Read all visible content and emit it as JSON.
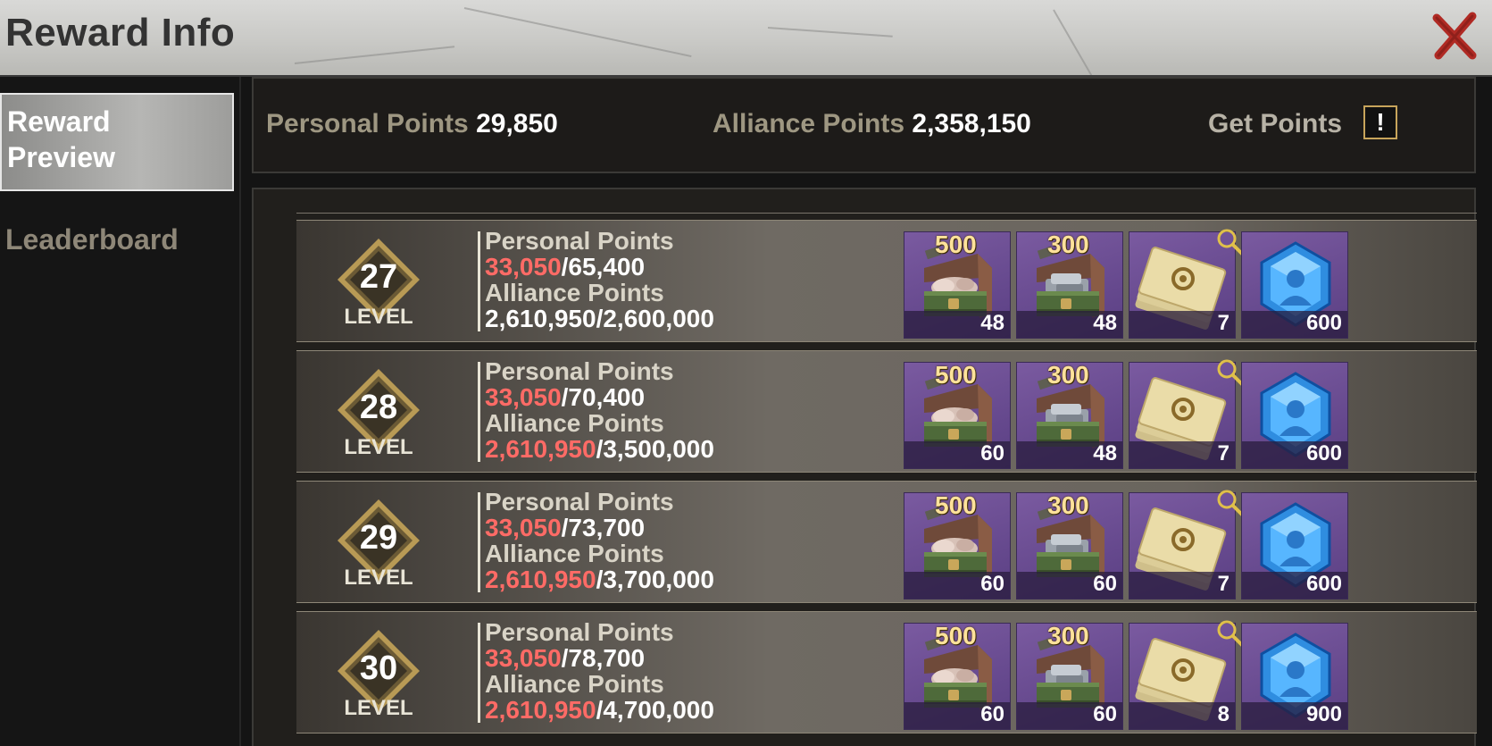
{
  "window": {
    "title": "Reward Info",
    "close_icon": "close-x-icon",
    "close_color": "#b02a24"
  },
  "sidebar": {
    "tabs": [
      {
        "label": "Reward Preview",
        "active": true
      },
      {
        "label": "Leaderboard",
        "active": false
      }
    ]
  },
  "summary": {
    "personal_label": "Personal Points",
    "personal_value": "29,850",
    "alliance_label": "Alliance Points",
    "alliance_value": "2,358,150",
    "get_points_label": "Get Points",
    "get_points_icon": "!"
  },
  "levels": [
    {
      "level": "27",
      "level_label": "LEVEL",
      "personal_label": "Personal Points",
      "personal_current": "33,050",
      "personal_target": "/65,400",
      "personal_met": false,
      "alliance_label": "Alliance Points",
      "alliance_current": "2,610,950",
      "alliance_target": "/2,600,000",
      "alliance_met": true,
      "rewards": [
        {
          "icon": "stone-chest-icon",
          "tag": "500",
          "count": "48"
        },
        {
          "icon": "iron-chest-icon",
          "tag": "300",
          "count": "48"
        },
        {
          "icon": "blueprint-tickets-icon",
          "tag": "",
          "count": "7",
          "inspect_icon": "magnifier-icon"
        },
        {
          "icon": "blue-crystal-icon",
          "tag": "",
          "count": "600"
        }
      ]
    },
    {
      "level": "28",
      "level_label": "LEVEL",
      "personal_label": "Personal Points",
      "personal_current": "33,050",
      "personal_target": "/70,400",
      "personal_met": false,
      "alliance_label": "Alliance Points",
      "alliance_current": "2,610,950",
      "alliance_target": "/3,500,000",
      "alliance_met": false,
      "rewards": [
        {
          "icon": "stone-chest-icon",
          "tag": "500",
          "count": "60"
        },
        {
          "icon": "iron-chest-icon",
          "tag": "300",
          "count": "48"
        },
        {
          "icon": "blueprint-tickets-icon",
          "tag": "",
          "count": "7",
          "inspect_icon": "magnifier-icon"
        },
        {
          "icon": "blue-crystal-icon",
          "tag": "",
          "count": "600"
        }
      ]
    },
    {
      "level": "29",
      "level_label": "LEVEL",
      "personal_label": "Personal Points",
      "personal_current": "33,050",
      "personal_target": "/73,700",
      "personal_met": false,
      "alliance_label": "Alliance Points",
      "alliance_current": "2,610,950",
      "alliance_target": "/3,700,000",
      "alliance_met": false,
      "rewards": [
        {
          "icon": "stone-chest-icon",
          "tag": "500",
          "count": "60"
        },
        {
          "icon": "iron-chest-icon",
          "tag": "300",
          "count": "60"
        },
        {
          "icon": "blueprint-tickets-icon",
          "tag": "",
          "count": "7",
          "inspect_icon": "magnifier-icon"
        },
        {
          "icon": "blue-crystal-icon",
          "tag": "",
          "count": "600"
        }
      ]
    },
    {
      "level": "30",
      "level_label": "LEVEL",
      "personal_label": "Personal Points",
      "personal_current": "33,050",
      "personal_target": "/78,700",
      "personal_met": false,
      "alliance_label": "Alliance Points",
      "alliance_current": "2,610,950",
      "alliance_target": "/4,700,000",
      "alliance_met": false,
      "rewards": [
        {
          "icon": "stone-chest-icon",
          "tag": "500",
          "count": "60"
        },
        {
          "icon": "iron-chest-icon",
          "tag": "300",
          "count": "60"
        },
        {
          "icon": "blueprint-tickets-icon",
          "tag": "",
          "count": "8",
          "inspect_icon": "magnifier-icon"
        },
        {
          "icon": "blue-crystal-icon",
          "tag": "",
          "count": "900"
        }
      ]
    }
  ],
  "colors": {
    "accent_gold": "#c7a45b",
    "unmet_red": "#ff6b66",
    "item_purple": "#6a4b93"
  }
}
